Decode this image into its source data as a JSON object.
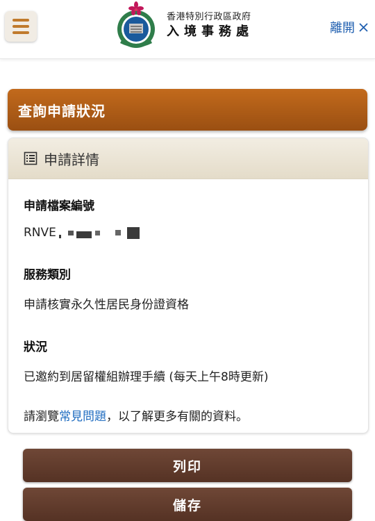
{
  "header": {
    "department_line1": "香港特別行政區政府",
    "department_line2": "入境事務處",
    "leave_label": "離開",
    "leave_icon": "close-icon",
    "menu_icon": "hamburger-menu-icon",
    "logo": "immigration-department-emblem"
  },
  "page_title": "查詢申請狀況",
  "panel": {
    "title": "申請詳情",
    "title_icon": "document-list-icon",
    "fields": [
      {
        "label": "申請檔案編號",
        "value": "RNVE"
      },
      {
        "label": "服務類別",
        "value": "申請核實永久性居民身份證資格"
      },
      {
        "label": "狀況",
        "value": "已邀約到居留權組辦理手續 (每天上午8時更新)"
      }
    ],
    "faq": {
      "prefix": "請瀏覽",
      "link": "常見問題",
      "suffix": "，以了解更多有關的資料。"
    }
  },
  "buttons": {
    "print_label": "列印",
    "save_label": "儲存"
  },
  "colors": {
    "title_bar": "#b0601a",
    "button": "#5e3a2a",
    "link": "#1f6cc0",
    "panel_header": "#ebe4d4"
  }
}
